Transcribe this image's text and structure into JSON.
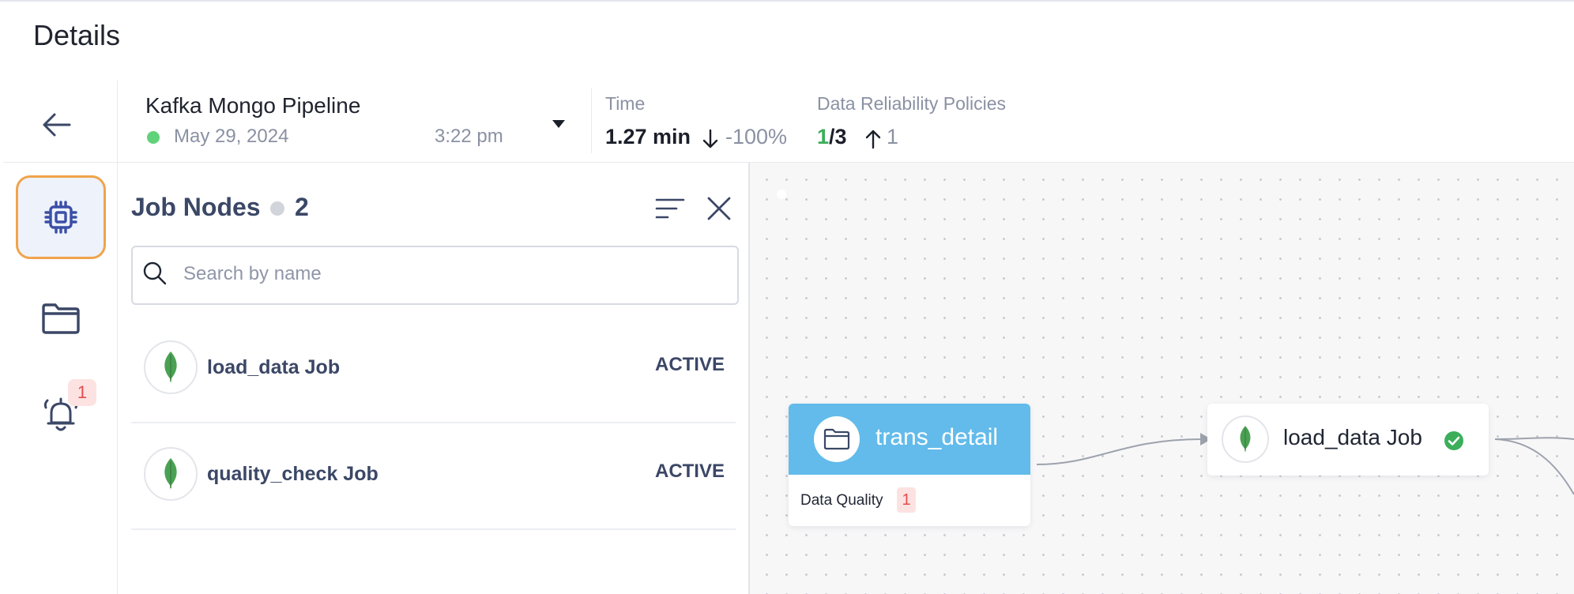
{
  "page": {
    "title": "Details"
  },
  "header": {
    "back_icon": "arrow-left-icon",
    "pipeline": {
      "name": "Kafka Mongo Pipeline",
      "status_color": "#5fd27a",
      "date": "May 29, 2024",
      "time": "3:22 pm",
      "dropdown_icon": "caret-down-icon"
    },
    "time_metric": {
      "label": "Time",
      "value": "1.27 min",
      "trend_icon": "arrow-down-icon",
      "delta": "-100%"
    },
    "policies_metric": {
      "label": "Data Reliability Policies",
      "passed": "1",
      "total": "/3",
      "pass_color": "#3cae5b",
      "trend_icon": "arrow-up-icon",
      "delta": "1"
    }
  },
  "sidebar": {
    "items": [
      {
        "icon": "cpu-chip-icon",
        "active": true
      },
      {
        "icon": "folder-icon",
        "active": false
      },
      {
        "icon": "alarm-bell-icon",
        "badge": "1"
      }
    ],
    "active_border_color": "#f0a44a"
  },
  "panel": {
    "title": "Job Nodes",
    "count": "2",
    "sort_icon": "sort-lines-icon",
    "close_icon": "close-icon",
    "search": {
      "placeholder": "Search by name",
      "value": ""
    },
    "jobs": [
      {
        "name": "load_data Job",
        "status": "ACTIVE",
        "icon": "mongodb-leaf-icon"
      },
      {
        "name": "quality_check Job",
        "status": "ACTIVE",
        "icon": "mongodb-leaf-icon"
      }
    ]
  },
  "canvas": {
    "nodes": [
      {
        "title": "trans_detail",
        "icon": "folder-icon",
        "header_color": "#62bbea",
        "metric_label": "Data Quality",
        "metric_badge": "1"
      },
      {
        "title": "load_data Job",
        "icon": "mongodb-leaf-icon",
        "status_icon": "check-circle-icon",
        "status_color": "#3cae5b"
      }
    ]
  }
}
